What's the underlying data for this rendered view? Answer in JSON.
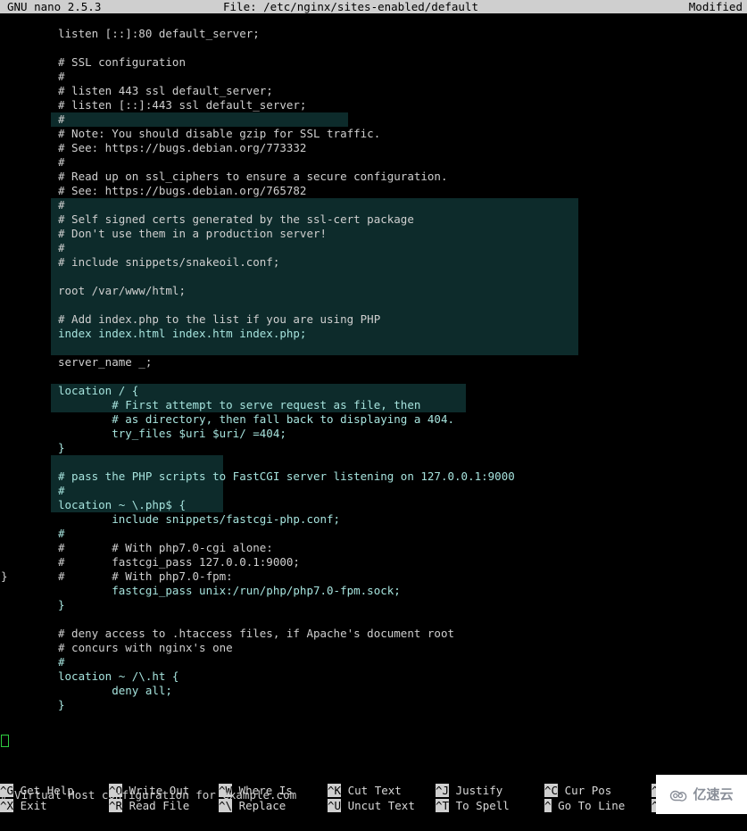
{
  "titlebar": {
    "version": "GNU nano 2.5.3",
    "file_label": "File: /etc/nginx/sites-enabled/default",
    "modified": "Modified"
  },
  "colors": {
    "titlebar_bg": "#cfcfcf",
    "editor_bg": "#000000",
    "text": "#cfcfcf",
    "selection_bg": "#0d2b2b",
    "selection_text": "#a6e3dd",
    "cursor_border": "#2ecc40"
  },
  "editor": {
    "lines": [
      {
        "n": 0,
        "text": "listen [::]:80 default_server;",
        "sel": false
      },
      {
        "n": 1,
        "text": "",
        "sel": false
      },
      {
        "n": 2,
        "text": "# SSL configuration",
        "sel": false
      },
      {
        "n": 3,
        "text": "#",
        "sel": false
      },
      {
        "n": 4,
        "text": "# listen 443 ssl default_server;",
        "sel": false
      },
      {
        "n": 5,
        "text": "# listen [::]:443 ssl default_server;",
        "sel": false
      },
      {
        "n": 6,
        "text": "#",
        "sel": false
      },
      {
        "n": 7,
        "text": "# Note: You should disable gzip for SSL traffic.",
        "sel": false
      },
      {
        "n": 8,
        "text": "# See: https://bugs.debian.org/773332",
        "sel": false
      },
      {
        "n": 9,
        "text": "#",
        "sel": false
      },
      {
        "n": 10,
        "text": "# Read up on ssl_ciphers to ensure a secure configuration.",
        "sel": false
      },
      {
        "n": 11,
        "text": "# See: https://bugs.debian.org/765782",
        "sel": false
      },
      {
        "n": 12,
        "text": "#",
        "sel": false
      },
      {
        "n": 13,
        "text": "# Self signed certs generated by the ssl-cert package",
        "sel": false
      },
      {
        "n": 14,
        "text": "# Don't use them in a production server!",
        "sel": false
      },
      {
        "n": 15,
        "text": "#",
        "sel": false
      },
      {
        "n": 16,
        "text": "# include snippets/snakeoil.conf;",
        "sel": false
      },
      {
        "n": 17,
        "text": "",
        "sel": false
      },
      {
        "n": 18,
        "text": "root /var/www/html;",
        "sel": false
      },
      {
        "n": 19,
        "text": "",
        "sel": false
      },
      {
        "n": 20,
        "text": "# Add index.php to the list if you are using PHP",
        "sel": false
      },
      {
        "n": 21,
        "text": "index index.html index.htm index.php;",
        "sel": true
      },
      {
        "n": 22,
        "text": "",
        "sel": false
      },
      {
        "n": 23,
        "text": "server_name _;",
        "sel": false
      },
      {
        "n": 24,
        "text": "",
        "sel": false
      },
      {
        "n": 25,
        "text": "location / {",
        "sel": true
      },
      {
        "n": 26,
        "text": "        # First attempt to serve request as file, then",
        "sel": true
      },
      {
        "n": 27,
        "text": "        # as directory, then fall back to displaying a 404.",
        "sel": true
      },
      {
        "n": 28,
        "text": "        try_files $uri $uri/ =404;",
        "sel": true
      },
      {
        "n": 29,
        "text": "}",
        "sel": true
      },
      {
        "n": 30,
        "text": "",
        "sel": true
      },
      {
        "n": 31,
        "text": "# pass the PHP scripts to FastCGI server listening on 127.0.0.1:9000",
        "sel": true
      },
      {
        "n": 32,
        "text": "#",
        "sel": true
      },
      {
        "n": 33,
        "text": "location ~ \\.php$ {",
        "sel": true
      },
      {
        "n": 34,
        "text": "        include snippets/fastcgi-php.conf;",
        "sel": true
      },
      {
        "n": 35,
        "text": "#",
        "sel": true
      },
      {
        "n": 36,
        "text": "#       # With php7.0-cgi alone:",
        "sel": false
      },
      {
        "n": 37,
        "text": "#       fastcgi_pass 127.0.0.1:9000;",
        "sel": false
      },
      {
        "n": 38,
        "text": "#       # With php7.0-fpm:",
        "sel": false
      },
      {
        "n": 39,
        "text": "        fastcgi_pass unix:/run/php/php7.0-fpm.sock;",
        "sel": true
      },
      {
        "n": 40,
        "text": "}",
        "sel": true
      },
      {
        "n": 41,
        "text": "",
        "sel": false
      },
      {
        "n": 42,
        "text": "# deny access to .htaccess files, if Apache's document root",
        "sel": false
      },
      {
        "n": 43,
        "text": "# concurs with nginx's one",
        "sel": false
      },
      {
        "n": 44,
        "text": "#",
        "sel": true
      },
      {
        "n": 45,
        "text": "location ~ /\\.ht {",
        "sel": true
      },
      {
        "n": 46,
        "text": "        deny all;",
        "sel": true
      },
      {
        "n": 47,
        "text": "}",
        "sel": true
      },
      {
        "n": 48,
        "text": "",
        "sel": false
      }
    ],
    "outdent_lines": [
      {
        "n": 49,
        "text": "}",
        "sel": false
      }
    ],
    "trailing_comment": "# Virtual Host configuration for example.com"
  },
  "footer": {
    "shortcuts": [
      {
        "key": "^G",
        "label": "Get Help"
      },
      {
        "key": "^O",
        "label": "Write Out"
      },
      {
        "key": "^W",
        "label": "Where Is"
      },
      {
        "key": "^K",
        "label": "Cut Text"
      },
      {
        "key": "^J",
        "label": "Justify"
      },
      {
        "key": "^C",
        "label": "Cur Pos"
      },
      {
        "key": "^Y",
        "label": ""
      },
      {
        "key": "^X",
        "label": "Exit"
      },
      {
        "key": "^R",
        "label": "Read File"
      },
      {
        "key": "^\\",
        "label": "Replace"
      },
      {
        "key": "^U",
        "label": "Uncut Text"
      },
      {
        "key": "^T",
        "label": "To Spell"
      },
      {
        "key": "^",
        "label": "Go To Line"
      },
      {
        "key": "^V",
        "label": ""
      }
    ]
  },
  "watermark": {
    "icon": "cloud-icon",
    "text": "亿速云"
  }
}
